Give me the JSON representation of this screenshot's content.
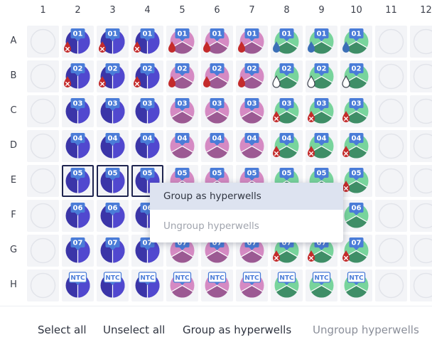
{
  "plate": {
    "columns": [
      "1",
      "2",
      "3",
      "4",
      "5",
      "6",
      "7",
      "8",
      "9",
      "10",
      "11",
      "12"
    ],
    "rows": [
      "A",
      "B",
      "C",
      "D",
      "E",
      "F",
      "G",
      "H"
    ],
    "wells": [
      {
        "row": "A",
        "col": 2,
        "label": "01",
        "color": "purple",
        "icon": "error-x-drop-icon"
      },
      {
        "row": "A",
        "col": 3,
        "label": "01",
        "color": "purple",
        "icon": "error-x-drop-icon"
      },
      {
        "row": "A",
        "col": 4,
        "label": "01",
        "color": "purple",
        "icon": "error-x-drop-icon"
      },
      {
        "row": "A",
        "col": 5,
        "label": "01",
        "color": "pink",
        "icon": "red-drop-icon"
      },
      {
        "row": "A",
        "col": 6,
        "label": "01",
        "color": "pink",
        "icon": "red-drop-icon"
      },
      {
        "row": "A",
        "col": 7,
        "label": "01",
        "color": "pink",
        "icon": "red-drop-icon"
      },
      {
        "row": "A",
        "col": 8,
        "label": "01",
        "color": "green",
        "icon": "blue-drop-icon"
      },
      {
        "row": "A",
        "col": 9,
        "label": "01",
        "color": "green",
        "icon": "blue-drop-icon"
      },
      {
        "row": "A",
        "col": 10,
        "label": "01",
        "color": "green",
        "icon": "blue-drop-icon"
      },
      {
        "row": "B",
        "col": 2,
        "label": "02",
        "color": "purple",
        "icon": "error-x-drop-icon"
      },
      {
        "row": "B",
        "col": 3,
        "label": "02",
        "color": "purple",
        "icon": "error-x-drop-icon"
      },
      {
        "row": "B",
        "col": 4,
        "label": "02",
        "color": "purple",
        "icon": "error-x-drop-icon"
      },
      {
        "row": "B",
        "col": 5,
        "label": "02",
        "color": "pink",
        "icon": "red-drop-icon"
      },
      {
        "row": "B",
        "col": 6,
        "label": "02",
        "color": "pink",
        "icon": "red-drop-icon"
      },
      {
        "row": "B",
        "col": 7,
        "label": "02",
        "color": "pink",
        "icon": "red-drop-icon"
      },
      {
        "row": "B",
        "col": 8,
        "label": "02",
        "color": "green",
        "icon": "outline-drop-icon"
      },
      {
        "row": "B",
        "col": 9,
        "label": "02",
        "color": "green",
        "icon": "outline-drop-icon"
      },
      {
        "row": "B",
        "col": 10,
        "label": "02",
        "color": "green",
        "icon": "outline-drop-icon"
      },
      {
        "row": "C",
        "col": 2,
        "label": "03",
        "color": "purple",
        "icon": ""
      },
      {
        "row": "C",
        "col": 3,
        "label": "03",
        "color": "purple",
        "icon": ""
      },
      {
        "row": "C",
        "col": 4,
        "label": "03",
        "color": "purple",
        "icon": ""
      },
      {
        "row": "C",
        "col": 5,
        "label": "03",
        "color": "pink",
        "icon": ""
      },
      {
        "row": "C",
        "col": 6,
        "label": "03",
        "color": "pink",
        "icon": ""
      },
      {
        "row": "C",
        "col": 7,
        "label": "03",
        "color": "pink",
        "icon": ""
      },
      {
        "row": "C",
        "col": 8,
        "label": "03",
        "color": "green",
        "icon": "error-x-drop-icon"
      },
      {
        "row": "C",
        "col": 9,
        "label": "03",
        "color": "green",
        "icon": "error-x-drop-icon"
      },
      {
        "row": "C",
        "col": 10,
        "label": "03",
        "color": "green",
        "icon": "error-x-drop-icon"
      },
      {
        "row": "D",
        "col": 2,
        "label": "04",
        "color": "purple",
        "icon": ""
      },
      {
        "row": "D",
        "col": 3,
        "label": "04",
        "color": "purple",
        "icon": ""
      },
      {
        "row": "D",
        "col": 4,
        "label": "04",
        "color": "purple",
        "icon": ""
      },
      {
        "row": "D",
        "col": 5,
        "label": "04",
        "color": "pink",
        "icon": ""
      },
      {
        "row": "D",
        "col": 6,
        "label": "04",
        "color": "pink",
        "icon": ""
      },
      {
        "row": "D",
        "col": 7,
        "label": "04",
        "color": "pink",
        "icon": ""
      },
      {
        "row": "D",
        "col": 8,
        "label": "04",
        "color": "green",
        "icon": "error-x-drop-icon"
      },
      {
        "row": "D",
        "col": 9,
        "label": "04",
        "color": "green",
        "icon": "error-x-drop-icon"
      },
      {
        "row": "D",
        "col": 10,
        "label": "04",
        "color": "green",
        "icon": "error-x-drop-icon"
      },
      {
        "row": "E",
        "col": 2,
        "label": "05",
        "color": "purple",
        "icon": "",
        "selected": true
      },
      {
        "row": "E",
        "col": 3,
        "label": "05",
        "color": "purple",
        "icon": "",
        "selected": true
      },
      {
        "row": "E",
        "col": 4,
        "label": "05",
        "color": "purple",
        "icon": "",
        "selected": true
      },
      {
        "row": "E",
        "col": 5,
        "label": "05",
        "color": "pink",
        "icon": ""
      },
      {
        "row": "E",
        "col": 6,
        "label": "05",
        "color": "pink",
        "icon": ""
      },
      {
        "row": "E",
        "col": 7,
        "label": "05",
        "color": "pink",
        "icon": ""
      },
      {
        "row": "E",
        "col": 8,
        "label": "05",
        "color": "green",
        "icon": ""
      },
      {
        "row": "E",
        "col": 9,
        "label": "05",
        "color": "green",
        "icon": ""
      },
      {
        "row": "E",
        "col": 10,
        "label": "05",
        "color": "green",
        "icon": "error-x-drop-icon"
      },
      {
        "row": "F",
        "col": 2,
        "label": "06",
        "color": "purple",
        "icon": ""
      },
      {
        "row": "F",
        "col": 3,
        "label": "06",
        "color": "purple",
        "icon": ""
      },
      {
        "row": "F",
        "col": 4,
        "label": "06",
        "color": "purple",
        "icon": ""
      },
      {
        "row": "F",
        "col": 10,
        "label": "06",
        "color": "green",
        "icon": ""
      },
      {
        "row": "G",
        "col": 2,
        "label": "07",
        "color": "purple",
        "icon": ""
      },
      {
        "row": "G",
        "col": 3,
        "label": "07",
        "color": "purple",
        "icon": ""
      },
      {
        "row": "G",
        "col": 4,
        "label": "07",
        "color": "purple",
        "icon": ""
      },
      {
        "row": "G",
        "col": 5,
        "label": "07",
        "color": "pink",
        "icon": ""
      },
      {
        "row": "G",
        "col": 6,
        "label": "07",
        "color": "pink",
        "icon": ""
      },
      {
        "row": "G",
        "col": 7,
        "label": "07",
        "color": "pink",
        "icon": ""
      },
      {
        "row": "G",
        "col": 8,
        "label": "07",
        "color": "green",
        "icon": "error-x-drop-icon"
      },
      {
        "row": "G",
        "col": 9,
        "label": "07",
        "color": "green",
        "icon": "error-x-drop-icon"
      },
      {
        "row": "G",
        "col": 10,
        "label": "07",
        "color": "green",
        "icon": "error-x-drop-icon"
      },
      {
        "row": "H",
        "col": 2,
        "label": "NTC",
        "color": "purple",
        "icon": ""
      },
      {
        "row": "H",
        "col": 3,
        "label": "NTC",
        "color": "purple",
        "icon": ""
      },
      {
        "row": "H",
        "col": 4,
        "label": "NTC",
        "color": "purple",
        "icon": ""
      },
      {
        "row": "H",
        "col": 5,
        "label": "NTC",
        "color": "pink",
        "icon": ""
      },
      {
        "row": "H",
        "col": 6,
        "label": "NTC",
        "color": "pink",
        "icon": ""
      },
      {
        "row": "H",
        "col": 7,
        "label": "NTC",
        "color": "pink",
        "icon": ""
      },
      {
        "row": "H",
        "col": 8,
        "label": "NTC",
        "color": "green",
        "icon": ""
      },
      {
        "row": "H",
        "col": 9,
        "label": "NTC",
        "color": "green",
        "icon": ""
      },
      {
        "row": "H",
        "col": 10,
        "label": "NTC",
        "color": "green",
        "icon": ""
      }
    ]
  },
  "palette": {
    "purple": {
      "top": "#3b35a8",
      "bottom": "#5148cf"
    },
    "pink": {
      "top": "#d58ac3",
      "bottom": "#9c5a93"
    },
    "green": {
      "top": "#78d49c",
      "bottom": "#3f8e67"
    },
    "label_bg": "#4a7cd8",
    "error_red": "#c42b2b",
    "water_blue": "#3c6fb7"
  },
  "context_menu": {
    "group_label": "Group as hyperwells",
    "ungroup_label": "Ungroup hyperwells"
  },
  "toolbar": {
    "select_all": "Select all",
    "unselect_all": "Unselect all",
    "group": "Group as hyperwells",
    "ungroup": "Ungroup hyperwells"
  }
}
